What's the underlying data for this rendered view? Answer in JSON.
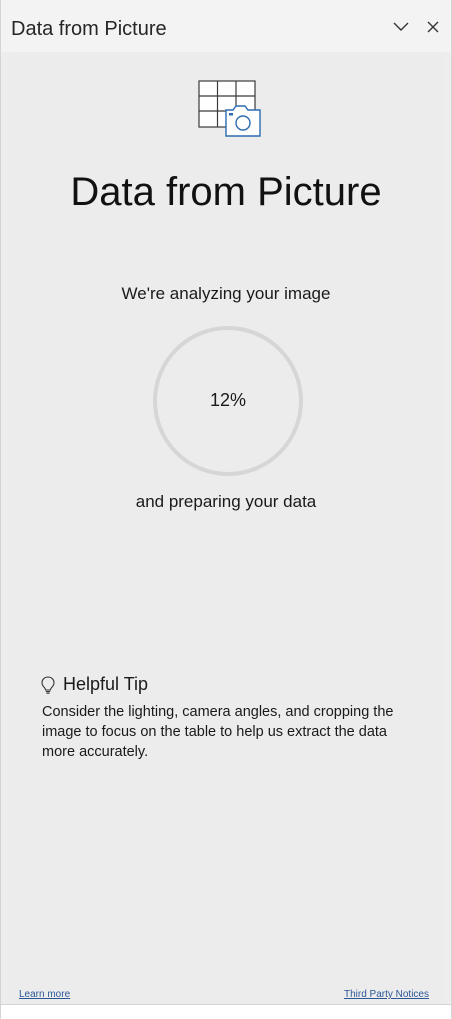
{
  "pane": {
    "title": "Data from Picture",
    "collapse_icon": "chevron-down-icon",
    "close_icon": "close-icon"
  },
  "hero": {
    "icon": "table-camera-icon",
    "title": "Data from Picture"
  },
  "status": {
    "analyzing": "We're analyzing your image",
    "progress_text": "12%",
    "progress_value": 0.12,
    "preparing": "and preparing your data"
  },
  "tip": {
    "icon": "lightbulb-icon",
    "title": "Helpful Tip",
    "body": "Consider the lighting, camera angles, and cropping the image to focus on the table to help us extract the data more accurately."
  },
  "footer": {
    "learn_more": "Learn more",
    "third_party": "Third Party Notices"
  },
  "colors": {
    "link": "#2b5797",
    "ring_track": "#d6d6d6",
    "icon_accent": "#2b6cb0"
  }
}
